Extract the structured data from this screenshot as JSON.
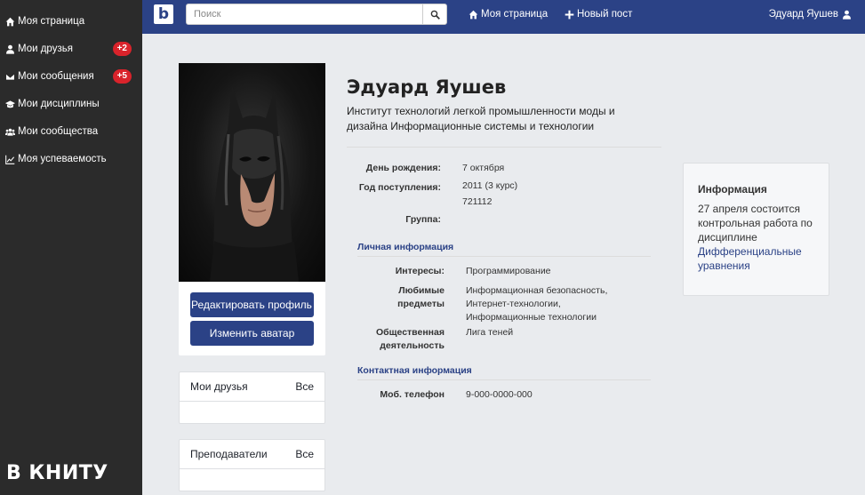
{
  "sidebar": {
    "items": [
      {
        "label": "Моя страница",
        "icon": "home-icon"
      },
      {
        "label": "Мои друзья",
        "icon": "user-icon",
        "badge": "+2"
      },
      {
        "label": "Мои сообщения",
        "icon": "envelope-icon",
        "badge": "+5"
      },
      {
        "label": "Мои дисциплины",
        "icon": "graduation-cap-icon"
      },
      {
        "label": "Мои сообщества",
        "icon": "users-icon"
      },
      {
        "label": "Моя успеваемость",
        "icon": "chart-line-icon"
      }
    ],
    "brand": "В КНИТУ"
  },
  "topbar": {
    "logo": "b",
    "search_placeholder": "Поиск",
    "nav_home": "Моя страница",
    "nav_new_post": "Новый пост",
    "user_name": "Эдуард Яушев"
  },
  "profile": {
    "edit_button": "Редактировать профиль",
    "avatar_button": "Изменить аватар",
    "name": "Эдуард Яушев",
    "institute": "Институт технологий легкой промышленности моды и дизайна Информационные системы и технологии",
    "birthday_label": "День рождения:",
    "birthday": "7 октября",
    "year_label": "Год поступления:",
    "year": "2011 (3 курс)",
    "group_label": "Группа:",
    "group": "721112",
    "personal_section": "Личная информация",
    "interests_label": "Интересы:",
    "interests": "Программирование",
    "fav_subjects_label": "Любимые предметы",
    "fav_subjects": [
      "Информационная безопасность,",
      "Интернет-технологии,",
      "Информационные технологии"
    ],
    "activity_label": "Общественная деятельность",
    "activity": "Лига теней",
    "contact_section": "Контактная информация",
    "phone_label": "Моб. телефон",
    "phone": "9-000-0000-000"
  },
  "friends_card": {
    "title": "Мои друзья",
    "all": "Все"
  },
  "teachers_card": {
    "title": "Преподаватели",
    "all": "Все"
  },
  "info_box": {
    "title": "Информация",
    "text": "27 апреля состоится контрольная работа по дисциплине",
    "link": "Дифференциальные уравнения"
  }
}
